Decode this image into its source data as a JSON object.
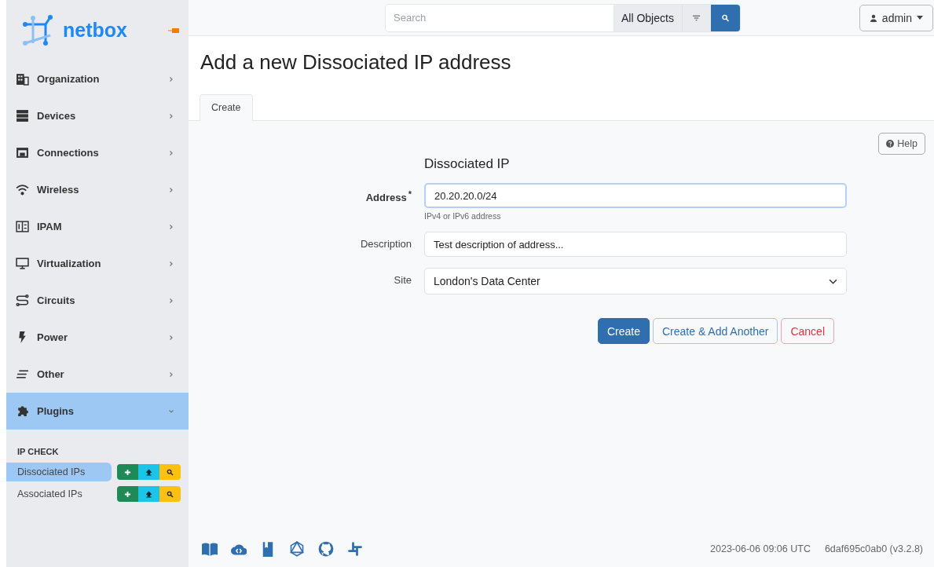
{
  "brand": "netbox",
  "sidebar": {
    "items": [
      {
        "label": "Organization",
        "expanded": false
      },
      {
        "label": "Devices",
        "expanded": false
      },
      {
        "label": "Connections",
        "expanded": false
      },
      {
        "label": "Wireless",
        "expanded": false
      },
      {
        "label": "IPAM",
        "expanded": false
      },
      {
        "label": "Virtualization",
        "expanded": false
      },
      {
        "label": "Circuits",
        "expanded": false
      },
      {
        "label": "Power",
        "expanded": false
      },
      {
        "label": "Other",
        "expanded": false
      },
      {
        "label": "Plugins",
        "expanded": true
      }
    ],
    "section": "IP CHECK",
    "sub_items": [
      {
        "label": "Dissociated IPs",
        "selected": true
      },
      {
        "label": "Associated IPs",
        "selected": false
      }
    ]
  },
  "search": {
    "placeholder": "Search",
    "scope": "All Objects"
  },
  "user": "admin",
  "page_title": "Add a new Dissociated IP address",
  "tabs": [
    {
      "label": "Create",
      "selected": true
    }
  ],
  "help": "Help",
  "form": {
    "heading": "Dissociated IP",
    "required_mark": "*",
    "fields": [
      {
        "kind": "text",
        "label": "Address",
        "required": true,
        "focused": true,
        "value": "20.20.20.0/24",
        "help": "IPv4 or IPv6 address"
      },
      {
        "kind": "text",
        "label": "Description",
        "required": false,
        "focused": false,
        "value": "Test description of address..."
      },
      {
        "kind": "select",
        "label": "Site",
        "required": false,
        "focused": false,
        "value": "London's Data Center"
      }
    ]
  },
  "buttons": [
    {
      "kind": "primary",
      "label": "Create"
    },
    {
      "kind": "outline",
      "label": "Create & Add Another"
    },
    {
      "kind": "danger",
      "label": "Cancel"
    }
  ],
  "footer": {
    "timestamp": "2023-06-06 09:06 UTC",
    "version": "6daf695c0ab0 (v3.2.8)"
  }
}
